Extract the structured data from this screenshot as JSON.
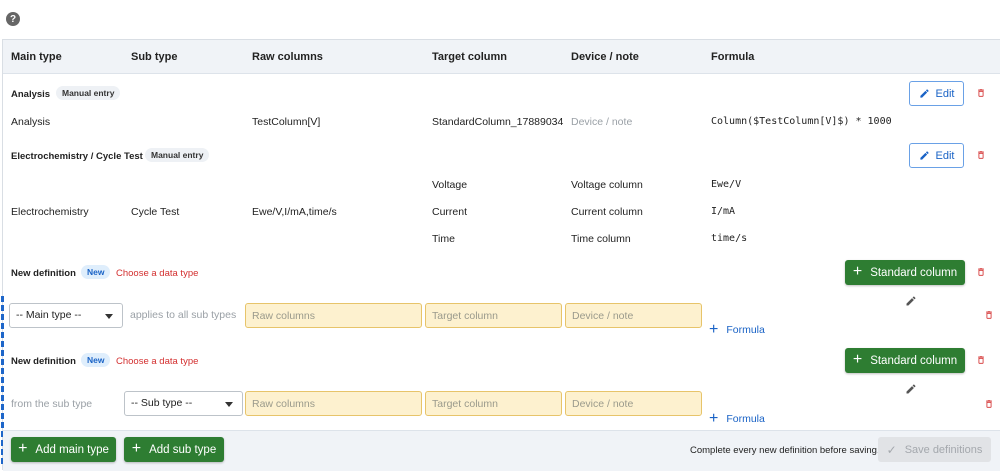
{
  "help_icon": "?",
  "columns": [
    "Main type",
    "Sub type",
    "Raw columns",
    "Target column",
    "Device / note",
    "Formula"
  ],
  "groups": [
    {
      "title": "Analysis",
      "badge": "Manual entry",
      "edit_label": "Edit",
      "row": {
        "main_type": "Analysis",
        "sub_type": "",
        "raw_columns": "TestColumn[V]",
        "target_column": "StandardColumn_17889034",
        "device_note": "Device / note",
        "formula": "Column($TestColumn[V]$) * 1000"
      }
    },
    {
      "title": "Electrochemistry / Cycle Test",
      "badge": "Manual entry",
      "edit_label": "Edit",
      "row": {
        "main_type": "Electrochemistry",
        "sub_type": "Cycle Test",
        "raw_columns": "Ewe/V,I/mA,time/s"
      },
      "mappings": [
        {
          "target": "Voltage",
          "device": "Voltage column",
          "formula": "Ewe/V"
        },
        {
          "target": "Current",
          "device": "Current column",
          "formula": "I/mA"
        },
        {
          "target": "Time",
          "device": "Time column",
          "formula": "time/s"
        }
      ]
    }
  ],
  "new_definitions": [
    {
      "title": "New definition",
      "badge": "New",
      "hint": "Choose a data type",
      "action_label": "Standard column",
      "select_value": "-- Main type --",
      "scope_text": "applies to all sub types",
      "raw_placeholder": "Raw columns",
      "target_placeholder": "Target column",
      "device_placeholder": "Device / note",
      "formula_label": "Formula"
    },
    {
      "title": "New definition",
      "badge": "New",
      "hint": "Choose a data type",
      "action_label": "Standard column",
      "scope_text": "from the sub type",
      "select_value": "-- Sub type --",
      "raw_placeholder": "Raw columns",
      "target_placeholder": "Target column",
      "device_placeholder": "Device / note",
      "formula_label": "Formula"
    }
  ],
  "footer": {
    "add_main_type": "Add main type",
    "add_sub_type": "Add sub type",
    "notice": "Complete every new definition before saving.",
    "save_label": "Save definitions"
  },
  "colors": {
    "accent_blue": "#1a63c6",
    "primary_green": "#2e7d32",
    "danger_red": "#d32f2f",
    "input_highlight": "#fdf1cf"
  }
}
